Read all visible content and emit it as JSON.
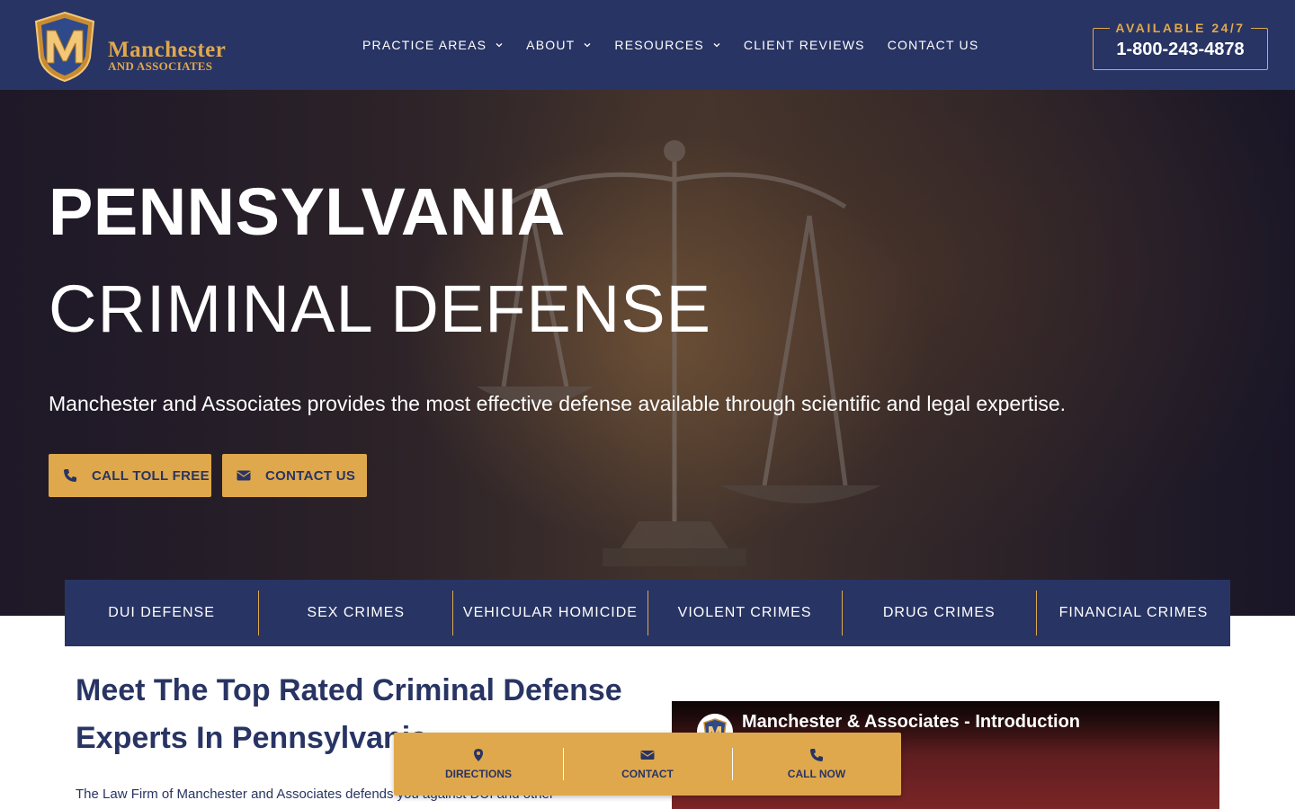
{
  "header": {
    "logo_name": "Manchester",
    "logo_sub": "AND ASSOCIATES",
    "nav": [
      {
        "label": "PRACTICE AREAS",
        "has_dropdown": true
      },
      {
        "label": "ABOUT",
        "has_dropdown": true
      },
      {
        "label": "RESOURCES",
        "has_dropdown": true
      },
      {
        "label": "CLIENT REVIEWS",
        "has_dropdown": false
      },
      {
        "label": "CONTACT US",
        "has_dropdown": false
      }
    ],
    "availability": "AVAILABLE 24/7",
    "phone": "1-800-243-4878"
  },
  "hero": {
    "title_line1": "PENNSYLVANIA",
    "title_line2": "CRIMINAL DEFENSE",
    "subtitle": "Manchester and Associates provides the most effective defense available through scientific and legal expertise.",
    "buttons": {
      "call": {
        "label": "CALL TOLL FREE",
        "icon": "phone-icon"
      },
      "contact": {
        "label": "CONTACT US",
        "icon": "envelope-icon"
      }
    }
  },
  "practice_areas": [
    "DUI DEFENSE",
    "SEX CRIMES",
    "VEHICULAR HOMICIDE",
    "VIOLENT CRIMES",
    "DRUG CRIMES",
    "FINANCIAL CRIMES"
  ],
  "main": {
    "title": "Meet The Top Rated Criminal Defense Experts In Pennsylvania",
    "intro": "The Law Firm of Manchester and Associates defends you against DUI and other"
  },
  "video": {
    "title": "Manchester & Associates - Introduction"
  },
  "floatbar": {
    "directions": "DIRECTIONS",
    "contact": "CONTACT",
    "call_now": "CALL NOW"
  },
  "colors": {
    "navy": "#283463",
    "gold": "#e0a84c",
    "white": "#ffffff"
  }
}
